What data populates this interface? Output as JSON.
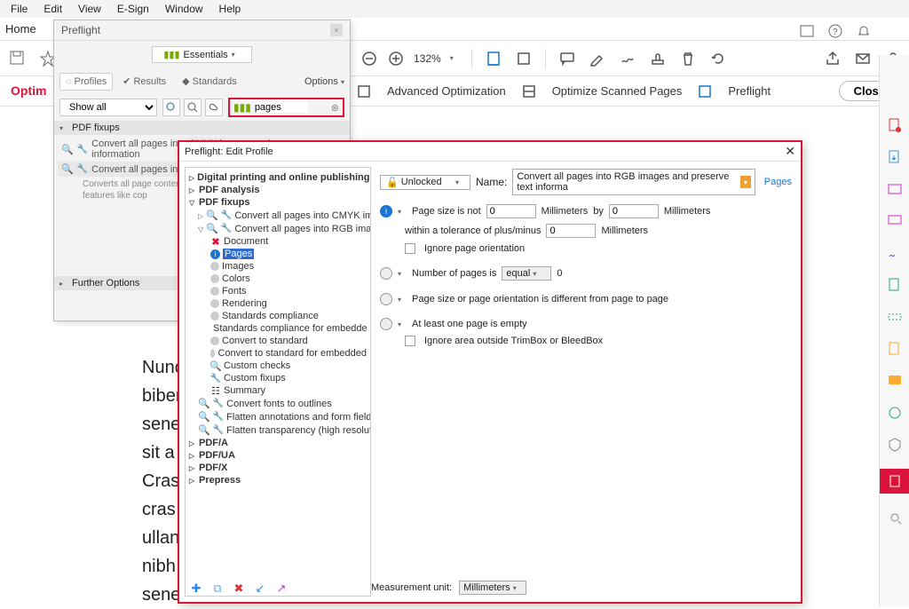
{
  "menu": {
    "file": "File",
    "edit": "Edit",
    "view": "View",
    "esign": "E-Sign",
    "window": "Window",
    "help": "Help"
  },
  "home": "Home",
  "zoom": "132%",
  "subtoolbar": {
    "adv": "Advanced Optimization",
    "scan": "Optimize Scanned Pages",
    "preflight": "Preflight",
    "close": "Close",
    "optimlabel": "Optim"
  },
  "preflight_panel": {
    "title": "Preflight",
    "essentials": "Essentials",
    "tabs": {
      "profiles": "Profiles",
      "results": "Results",
      "standards": "Standards"
    },
    "options": "Options",
    "showall": "Show all",
    "search": "pages",
    "section_fixups": "PDF fixups",
    "items": {
      "cmyk": "Convert all pages into CMYK images and preserve text information",
      "rgb": "Convert all pages into RG",
      "desc": "Converts all page conten\nquality) and creates an in\npreserve features like cop"
    },
    "further": "Further Options"
  },
  "edit_dialog": {
    "title": "Preflight: Edit Profile",
    "unlocked": "Unlocked",
    "name_lbl": "Name:",
    "name_val": "Convert all pages into RGB images and preserve text informa",
    "pages_tab": "Pages",
    "tree": {
      "n0": "Digital printing and online publishing",
      "n1": "PDF analysis",
      "n2": "PDF fixups",
      "n2a": "Convert all pages into CMYK images",
      "n2b": "Convert all pages into RGB images a",
      "doc": "Document",
      "pages": "Pages",
      "images": "Images",
      "colors": "Colors",
      "fonts": "Fonts",
      "render": "Rendering",
      "std": "Standards compliance",
      "stde": "Standards compliance for embedde",
      "conv": "Convert to standard",
      "conve": "Convert to standard for embedded",
      "cc": "Custom checks",
      "cf": "Custom fixups",
      "sum": "Summary",
      "f1": "Convert fonts to outlines",
      "f2": "Flatten annotations and form fields",
      "f3": "Flatten transparency (high resolutio",
      "pdfa": "PDF/A",
      "pdfua": "PDF/UA",
      "pdfx": "PDF/X",
      "prepress": "Prepress"
    },
    "form": {
      "psizenot": "Page size is not",
      "mm": "Millimeters",
      "by": "by",
      "within": "within a tolerance of plus/minus",
      "ignoreorient": "Ignore page orientation",
      "numpages": "Number of pages is",
      "equal": "equal",
      "sizediff": "Page size or page orientation is different from page to page",
      "empty": "At least one page is empty",
      "ignorearea": "Ignore area outside TrimBox or BleedBox",
      "v0": "0",
      "v0b": "0",
      "v0c": "0",
      "v0d": "0",
      "munit": "Measurement unit:",
      "munit_val": "Millimeters"
    }
  },
  "doc_lines": [
    "Nunc",
    "biber",
    "sene",
    "sit a",
    "Cras",
    "cras",
    "ullan",
    "nibh",
    "sene"
  ]
}
